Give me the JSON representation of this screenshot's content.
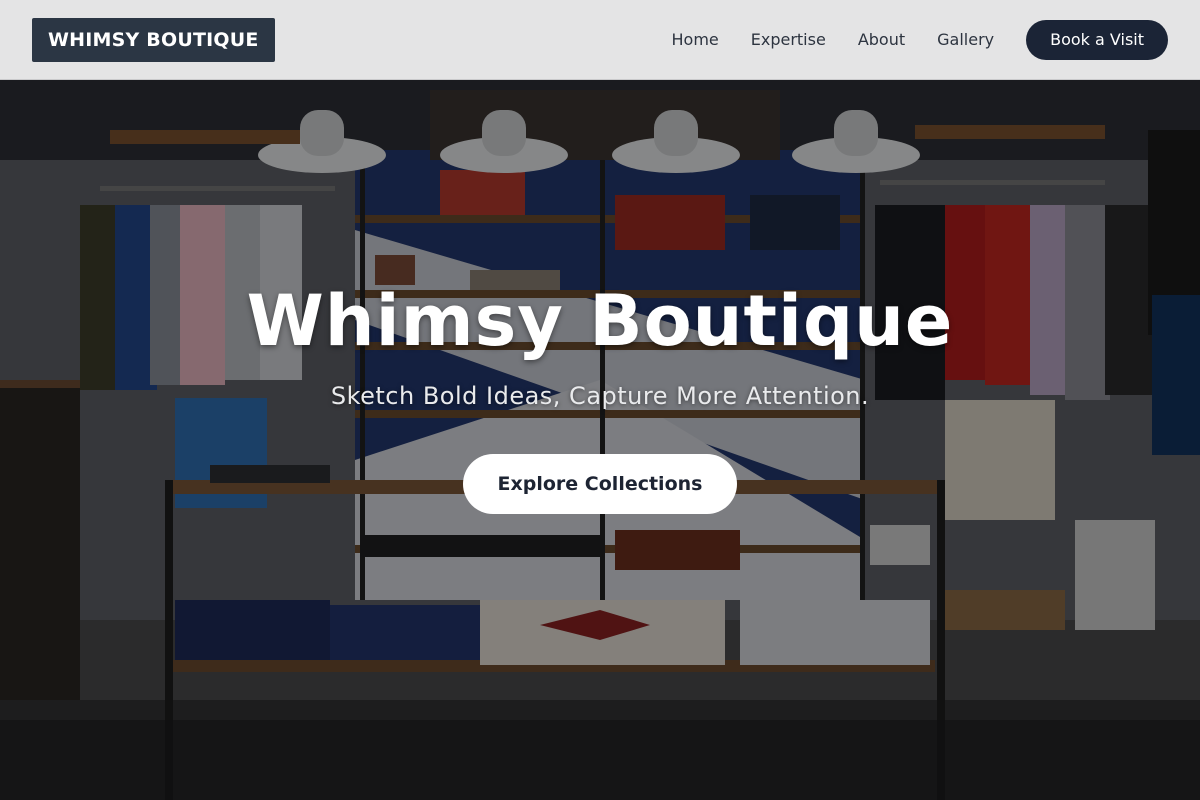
{
  "header": {
    "logo": "WHIMSY BOUTIQUE",
    "nav": [
      {
        "label": "Home"
      },
      {
        "label": "Expertise"
      },
      {
        "label": "About"
      },
      {
        "label": "Gallery"
      }
    ],
    "cta_label": "Book a Visit"
  },
  "hero": {
    "title": "Whimsy Boutique",
    "subtitle": "Sketch Bold Ideas, Capture More Attention.",
    "button_label": "Explore Collections",
    "background_image": "boutique-store-interior-photo"
  },
  "colors": {
    "header_bg": "#e4e4e5",
    "logo_bg": "#2b3644",
    "cta_bg": "#1b2436",
    "hero_button_bg": "#ffffff"
  }
}
